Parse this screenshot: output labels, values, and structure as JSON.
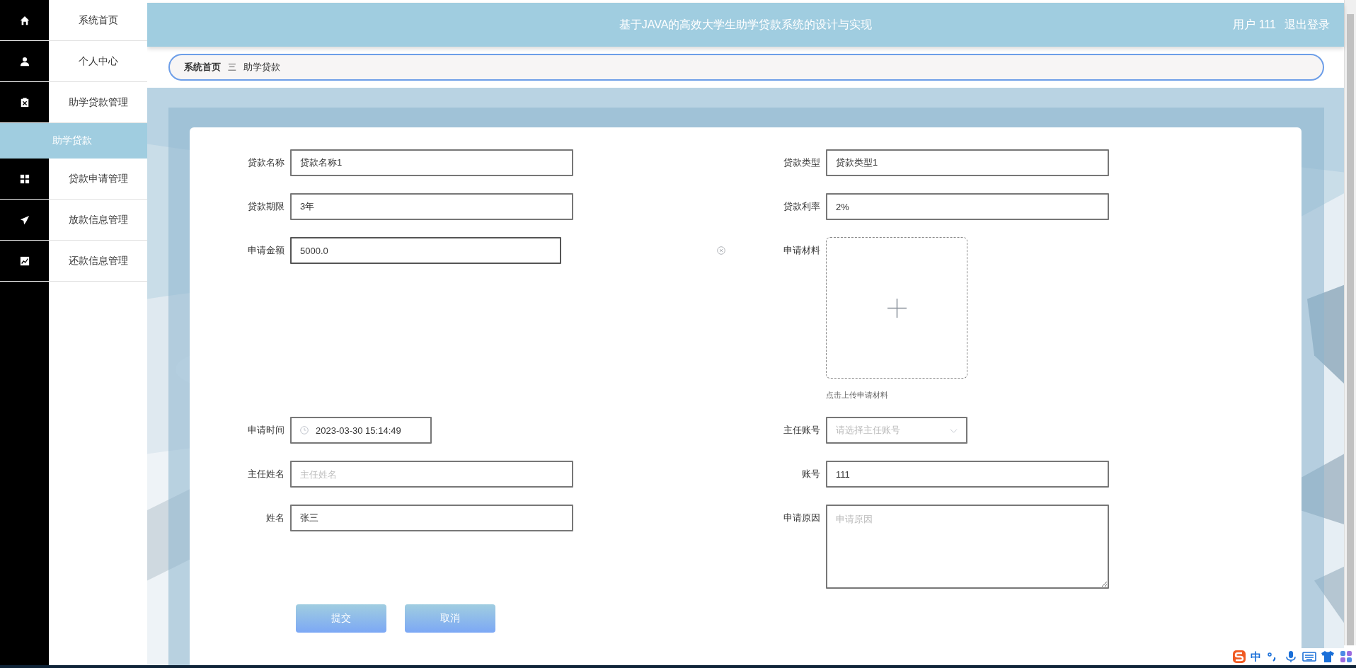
{
  "sidebar": {
    "items": [
      {
        "label": "系统首页",
        "selected": false
      },
      {
        "label": "个人中心",
        "selected": false
      },
      {
        "label": "助学贷款管理",
        "selected": false,
        "expanded": true,
        "children": [
          {
            "label": "助学贷款",
            "selected": true
          }
        ]
      },
      {
        "label": "贷款申请管理",
        "selected": false
      },
      {
        "label": "放款信息管理",
        "selected": false
      },
      {
        "label": "还款信息管理",
        "selected": false
      }
    ]
  },
  "header": {
    "title": "基于JAVA的高效大学生助学贷款系统的设计与实现",
    "user": "用户 111",
    "logout": "退出登录"
  },
  "breadcrumb": {
    "items": [
      "系统首页",
      "助学贷款"
    ],
    "separator": "三"
  },
  "form": {
    "rows": [
      {
        "left": {
          "label": "贷款名称",
          "kind": "text",
          "value": "贷款名称1"
        },
        "right": {
          "label": "贷款类型",
          "kind": "text",
          "value": "贷款类型1"
        }
      },
      {
        "left": {
          "label": "贷款期限",
          "kind": "text",
          "value": "3年"
        },
        "right": {
          "label": "贷款利率",
          "kind": "text",
          "value": "2%"
        }
      },
      {
        "left": {
          "label": "申请金额",
          "kind": "text",
          "value": "5000.0",
          "focused": true,
          "clearable": true
        },
        "right": {
          "label": "申请材料",
          "kind": "upload",
          "hint": "点击上传申请材料"
        }
      },
      {
        "left": {
          "label": "申请时间",
          "kind": "datetime",
          "value": "2023-03-30 15:14:49"
        },
        "right": {
          "label": "主任账号",
          "kind": "select",
          "placeholder": "请选择主任账号"
        }
      },
      {
        "left": {
          "label": "主任姓名",
          "kind": "text",
          "placeholder": "主任姓名"
        },
        "right": {
          "label": "账号",
          "kind": "text",
          "value": "111"
        }
      },
      {
        "left": {
          "label": "姓名",
          "kind": "text",
          "value": "张三"
        },
        "right": {
          "label": "申请原因",
          "kind": "textarea",
          "placeholder": "申请原因"
        }
      }
    ],
    "buttons": [
      "提交",
      "取消"
    ]
  },
  "ime_toolbar": {
    "mode": "中"
  }
}
